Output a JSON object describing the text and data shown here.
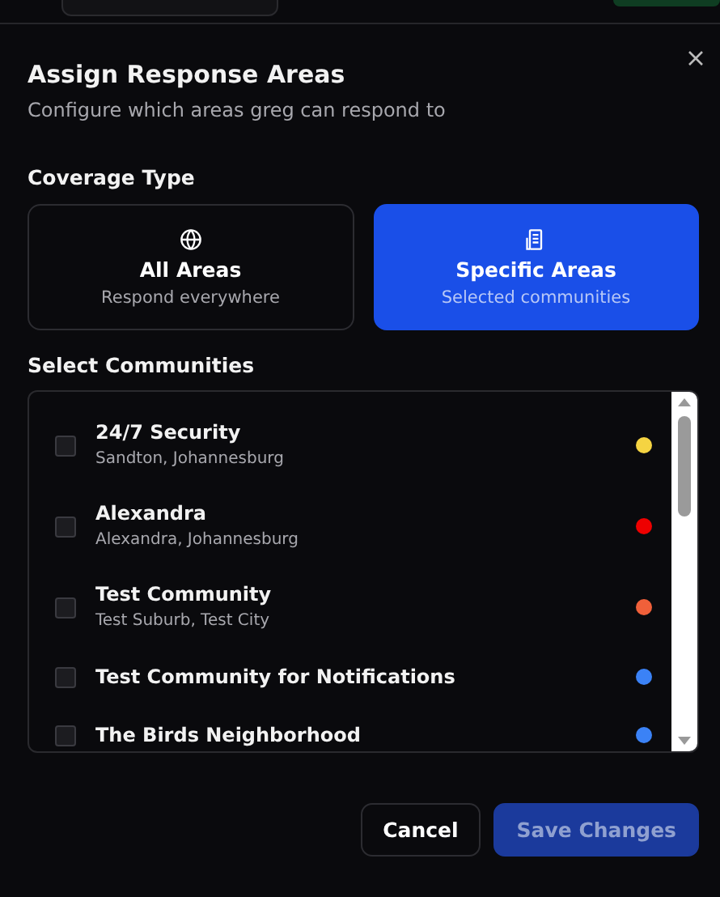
{
  "dialog": {
    "title": "Assign Response Areas",
    "subtitle": "Configure which areas greg can respond to",
    "coverage": {
      "label": "Coverage Type",
      "options": [
        {
          "kind": "globe",
          "title": "All Areas",
          "description": "Respond everywhere",
          "selected": false
        },
        {
          "kind": "building",
          "title": "Specific Areas",
          "description": "Selected communities",
          "selected": true
        }
      ]
    },
    "communities": {
      "label": "Select Communities",
      "items": [
        {
          "name": "24/7 Security",
          "location": "Sandton, Johannesburg",
          "checked": false,
          "color": "#f5d442"
        },
        {
          "name": "Alexandra",
          "location": "Alexandra, Johannesburg",
          "checked": false,
          "color": "#ee0000"
        },
        {
          "name": "Test Community",
          "location": "Test Suburb, Test City",
          "checked": false,
          "color": "#f0603a"
        },
        {
          "name": "Test Community for Notifications",
          "checked": false,
          "color": "#3b82f6"
        },
        {
          "name": "The Birds Neighborhood",
          "checked": false,
          "color": "#3b82f6"
        }
      ]
    },
    "buttons": [
      {
        "kind": "secondary",
        "label": "Cancel",
        "disabled": false
      },
      {
        "kind": "primary",
        "label": "Save Changes",
        "disabled": true
      }
    ]
  }
}
